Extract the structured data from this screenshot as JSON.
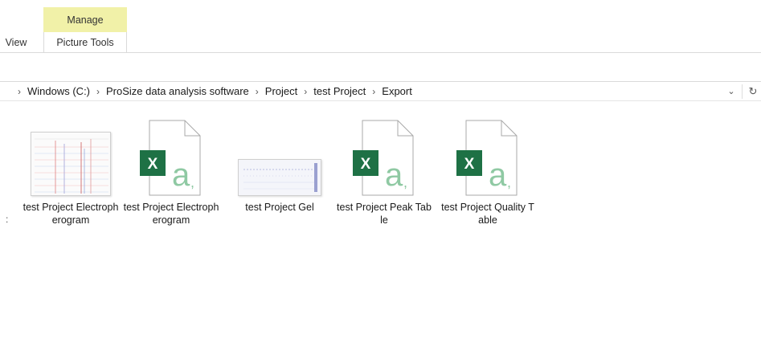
{
  "ribbon": {
    "manage_label": "Manage",
    "view_tab": "View",
    "picture_tools_tab": "Picture Tools"
  },
  "address_bar": {
    "crumbs": [
      "Windows (C:)",
      "ProSize data analysis software",
      "Project",
      "test Project",
      "Export"
    ],
    "separator": "›"
  },
  "files": [
    {
      "name": "test Project Electropherogram",
      "type": "image",
      "icon": "image-thumbnail-icon"
    },
    {
      "name": "test Project Electropherogram",
      "type": "excel",
      "icon": "excel-file-icon"
    },
    {
      "name": "test Project Gel",
      "type": "image",
      "icon": "image-thumbnail-icon"
    },
    {
      "name": "test Project Peak Table",
      "type": "excel",
      "icon": "excel-file-icon"
    },
    {
      "name": "test Project Quality Table",
      "type": "excel",
      "icon": "excel-file-icon"
    }
  ],
  "colors": {
    "manage_bg": "#f1f1a8",
    "excel_green": "#1e7145",
    "excel_letter": "#8fc9a3"
  }
}
